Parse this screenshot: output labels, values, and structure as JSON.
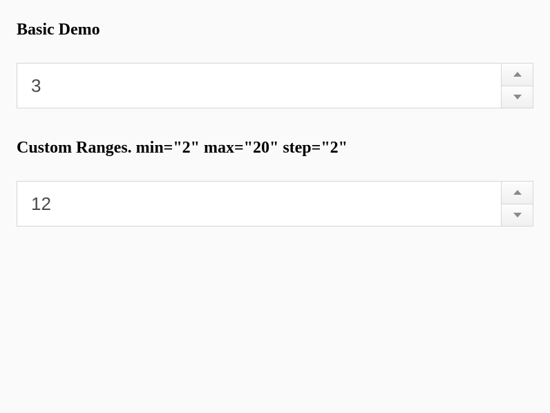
{
  "sections": {
    "basic": {
      "title": "Basic Demo",
      "value": "3"
    },
    "custom": {
      "title": "Custom Ranges. min=\"2\" max=\"20\" step=\"2\"",
      "value": "12",
      "min": "2",
      "max": "20",
      "step": "2"
    }
  }
}
